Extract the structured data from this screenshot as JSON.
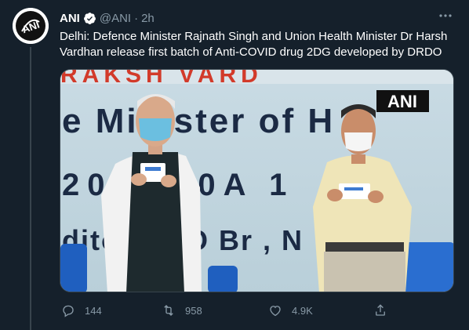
{
  "tweet": {
    "author_name": "ANI",
    "handle": "@ANI",
    "separator": "·",
    "time": "2h",
    "text": "Delhi: Defence Minister Rajnath Singh and Union Health Minister Dr Harsh Vardhan release first batch of Anti-COVID drug 2DG developed by DRDO",
    "avatar_text": "ANI",
    "media": {
      "watermark": "ANI",
      "backdrop_rows": [
        "RAKSH VARD",
        "e Minister of H",
        "20 0:30A 1",
        "ditor RDO Br , N"
      ]
    }
  },
  "actions": {
    "reply_count": "144",
    "retweet_count": "958",
    "like_count": "4.9K"
  },
  "colors": {
    "background": "#15202b",
    "secondary_text": "#8899a6",
    "verified": "#ffffff"
  },
  "icons": [
    "verified-badge-icon",
    "more-options-icon",
    "reply-icon",
    "retweet-icon",
    "like-icon",
    "share-icon"
  ]
}
